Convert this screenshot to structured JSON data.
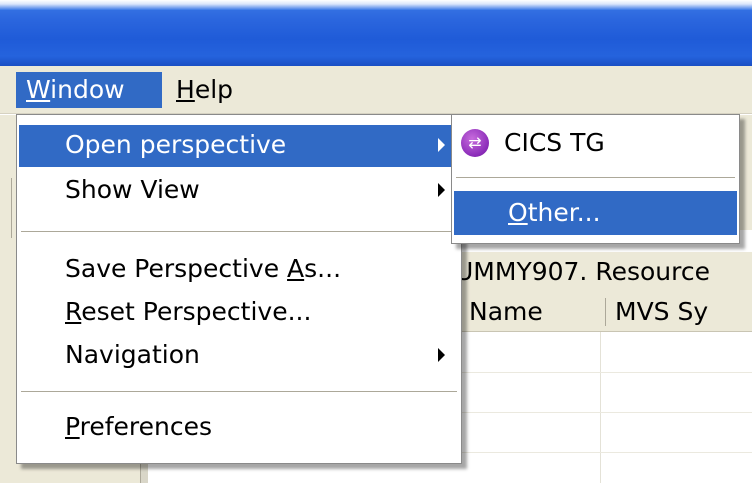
{
  "menubar": {
    "window": {
      "mnemonic": "W",
      "rest": "indow"
    },
    "help": {
      "mnemonic": "H",
      "rest": "elp"
    }
  },
  "window_menu": {
    "open_perspective": "Open perspective",
    "show_view": "Show View",
    "save_perspective": {
      "before": "Save Perspective ",
      "mnemonic": "A",
      "after": "s..."
    },
    "reset_perspective": {
      "mnemonic": "R",
      "rest": "eset Perspective..."
    },
    "navigation": "Navigation",
    "preferences": {
      "mnemonic": "P",
      "rest": "references"
    }
  },
  "perspective_submenu": {
    "cics_tg": "CICS TG",
    "cics_tg_icon": "perspective-arrows-icon",
    "other": {
      "mnemonic": "O",
      "rest": "ther..."
    }
  },
  "background": {
    "resource_text": "UMMY907. Resource",
    "column_name": "Name",
    "column_mvs": "MVS Sy"
  },
  "colors": {
    "highlight": "#316ac5",
    "menu_background": "#ffffff",
    "menubar_background": "#ece9d8",
    "titlebar": "#2563dd",
    "cics_icon": "#8a2bb8"
  }
}
